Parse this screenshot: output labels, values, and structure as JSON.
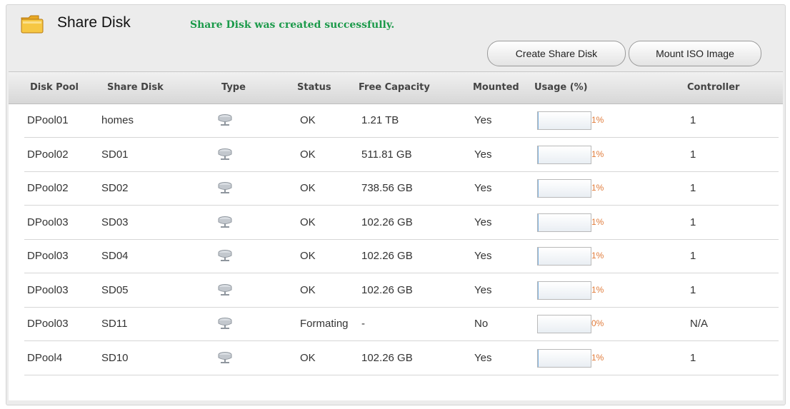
{
  "header": {
    "title": "Share Disk",
    "message": "Share Disk was created successfully.",
    "create_button": "Create Share Disk",
    "mount_button": "Mount ISO Image"
  },
  "table": {
    "columns": [
      "Disk Pool",
      "Share Disk",
      "Type",
      "Status",
      "Free Capacity",
      "Mounted",
      "Usage (%)",
      "Controller"
    ],
    "rows": [
      {
        "pool": "DPool01",
        "disk": "homes",
        "type_icon": "share-disk-icon",
        "status": "OK",
        "free": "1.21 TB",
        "mounted": "Yes",
        "usage": "1%",
        "usage_value": 1,
        "controller": "1"
      },
      {
        "pool": "DPool02",
        "disk": "SD01",
        "type_icon": "share-disk-icon",
        "status": "OK",
        "free": "511.81 GB",
        "mounted": "Yes",
        "usage": "1%",
        "usage_value": 1,
        "controller": "1"
      },
      {
        "pool": "DPool02",
        "disk": "SD02",
        "type_icon": "share-disk-icon",
        "status": "OK",
        "free": "738.56 GB",
        "mounted": "Yes",
        "usage": "1%",
        "usage_value": 1,
        "controller": "1"
      },
      {
        "pool": "DPool03",
        "disk": "SD03",
        "type_icon": "share-disk-icon",
        "status": "OK",
        "free": "102.26 GB",
        "mounted": "Yes",
        "usage": "1%",
        "usage_value": 1,
        "controller": "1"
      },
      {
        "pool": "DPool03",
        "disk": "SD04",
        "type_icon": "share-disk-icon",
        "status": "OK",
        "free": "102.26 GB",
        "mounted": "Yes",
        "usage": "1%",
        "usage_value": 1,
        "controller": "1"
      },
      {
        "pool": "DPool03",
        "disk": "SD05",
        "type_icon": "share-disk-icon",
        "status": "OK",
        "free": "102.26 GB",
        "mounted": "Yes",
        "usage": "1%",
        "usage_value": 1,
        "controller": "1"
      },
      {
        "pool": "DPool03",
        "disk": "SD11",
        "type_icon": "share-disk-icon",
        "status": "Formating",
        "free": "-",
        "mounted": "No",
        "usage": "0%",
        "usage_value": 0,
        "controller": "N/A"
      },
      {
        "pool": "DPool4",
        "disk": "SD10",
        "type_icon": "share-disk-icon",
        "status": "OK",
        "free": "102.26 GB",
        "mounted": "Yes",
        "usage": "1%",
        "usage_value": 1,
        "controller": "1"
      }
    ]
  },
  "colors": {
    "success": "#1b9a4a",
    "usage_text": "#e07b3a",
    "usage_fill": "#7fb2e0"
  }
}
